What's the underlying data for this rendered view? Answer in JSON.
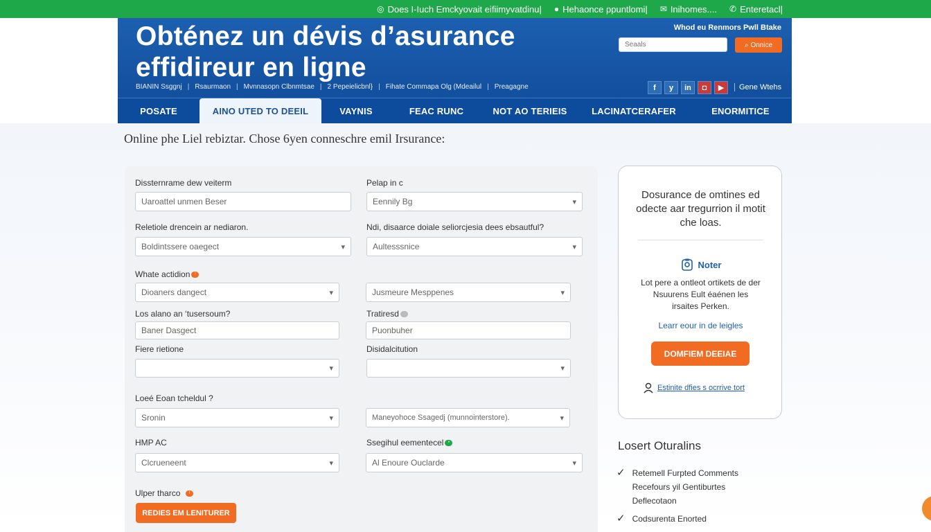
{
  "topbar": {
    "items": [
      {
        "icon": "globe-icon",
        "label": "Does I-Iuch Emckyovait eifiimyvatdinu|"
      },
      {
        "icon": "pin-icon",
        "label": "Hehaonce ppuntlomi|"
      },
      {
        "icon": "chat-icon",
        "label": "Inihomes...."
      },
      {
        "icon": "phone-icon",
        "label": "Enteretacl|"
      }
    ]
  },
  "header": {
    "title": "Obténez un dévis d’asurance effidireur en ligne",
    "tagline": "Whod eu Renmors Pwll Btake",
    "search": {
      "placeholder": "Seaals",
      "button": "Onnice"
    },
    "breadcrumb": [
      "BIANIN Ssggnj",
      "Rsaurmaon",
      "Mvnnasopn Clbnmtsae",
      "2 Pepeielicbnl}",
      "Fihate Commapa Olg (Mdeailul",
      "Preagagne"
    ],
    "social": [
      {
        "icon": "facebook-icon",
        "glyph": "f"
      },
      {
        "icon": "twitter-icon",
        "glyph": "y"
      },
      {
        "icon": "linkedin-icon",
        "glyph": "in"
      },
      {
        "icon": "instagram-icon",
        "glyph": "◘"
      },
      {
        "icon": "youtube-icon",
        "glyph": "▶"
      }
    ],
    "contact": "Gene Wtehs"
  },
  "nav": [
    {
      "label": "POSATE",
      "active": false
    },
    {
      "label": "AINO UTED TO DEEIL",
      "active": true
    },
    {
      "label": "VAYNIS",
      "active": false
    },
    {
      "label": "FEAC RUNC",
      "active": false
    },
    {
      "label": "NOT AO TERIEIS",
      "active": false
    },
    {
      "label": "LACINATCERAFER",
      "active": false
    },
    {
      "label": "ENORMITICE",
      "active": false
    }
  ],
  "page_heading": "Online phe Liel rebiztar. Chose 6yen conneschre emil Irsurance:",
  "form": {
    "fields": [
      {
        "label": "Dissternrame dew veiterm",
        "value": "Uaroattel unmen Beser",
        "select": false
      },
      {
        "label": "Pelap in c",
        "value": "Eennily Bg",
        "select": true
      },
      {
        "label": "Reletiole drencein ar nediaron.",
        "value": "Boldintssere oaegect",
        "select": true
      },
      {
        "label": "Ndi, disaarce doiale seliorcjesia dees ebsautful?",
        "value": "Aultesssnice",
        "select": true
      },
      {
        "label": "Whate actidion",
        "value": "Dioaners dangect",
        "select": true
      },
      {
        "label": "",
        "value": "Jusmeure Mesppenes",
        "select": true
      },
      {
        "label": "Los alano an ‘tusersoum?",
        "value": "Baner Dasgect",
        "select": false
      },
      {
        "label": "Tratiresd",
        "value": "Puonbuher",
        "select": false
      },
      {
        "label": "Fiere rietione",
        "value": "",
        "select": true
      },
      {
        "label": "Disidalcitution",
        "value": "",
        "select": true
      },
      {
        "label": "Loeé Eoan tcheldul ?",
        "value": "Sronin",
        "select": true
      },
      {
        "label": "",
        "value": "Maneyohoce Ssagedj (munnointerstore).",
        "select": true
      },
      {
        "label": "HMP AC",
        "value": "Clcrueneent",
        "select": true
      },
      {
        "label": "Ssegihul eementecel",
        "value": "Al Enoure Ouclarde",
        "select": true
      }
    ],
    "bottom_label": "Ulper tharco",
    "submit": "REDIES EM LENITURER"
  },
  "sidebar_card": {
    "title": "Dosurance de omtines ed odecte aar tregurrion il motit che loas.",
    "note_title": "Noter",
    "note_desc": "Lot pere a ontleot ortikets de der Nsuurens Eult éaénen les irsaites Perken.",
    "link": "Learr eour in de leigles",
    "button": "DOMFIEM DEEIAE",
    "user_link": "Estinite dfies s ocrrive tort"
  },
  "losers": {
    "title": "Losert Oturalins",
    "items": [
      "Retemell Furpted Comments Recefours yil Gentiburtes Deflecotaon",
      "Codsurenta Enorted"
    ]
  },
  "colors": {
    "green": "#1fa84a",
    "blue": "#0f4a98",
    "orange": "#f26b23",
    "link": "#1d5fb0"
  }
}
